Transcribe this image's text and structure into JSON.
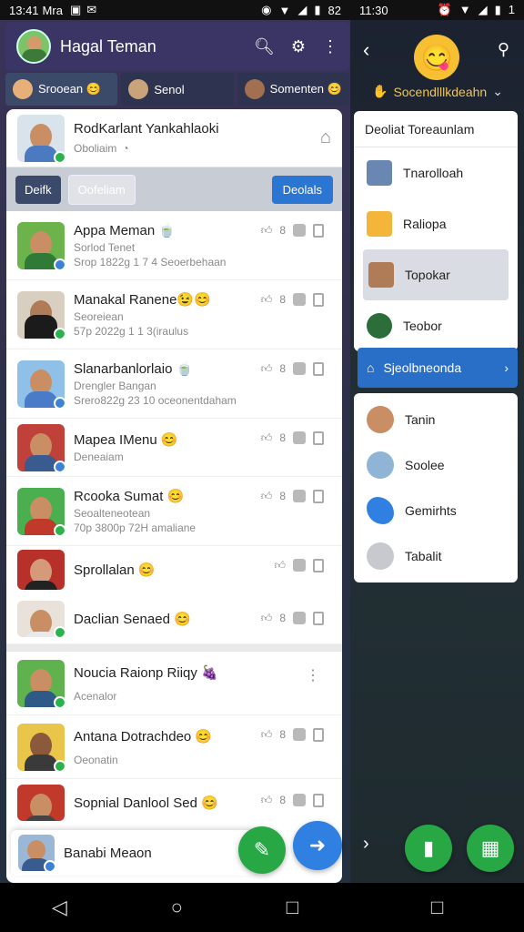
{
  "status_left": {
    "time": "13:41",
    "carrier": "Mra",
    "right": "82"
  },
  "status_right": {
    "time": "11:30",
    "right": "1"
  },
  "appbar": {
    "title": "Hagal Teman"
  },
  "tabs": [
    {
      "label": "Srooean 😊"
    },
    {
      "label": "Senol"
    },
    {
      "label": "Somenten 😊"
    }
  ],
  "header": {
    "name": "RodKarlant Yankahlaoki",
    "sub": "Oboliaim"
  },
  "actions": {
    "left1": "Deifk",
    "left2": "Oofeliam",
    "right": "Deolals"
  },
  "contacts": [
    {
      "name": "Appa Meman 🍵",
      "s1": "Sorlod Tenet",
      "s2": "Srop 1822g 1 7 4 Seoerbehaan"
    },
    {
      "name": "Manakal Ranene😉😊",
      "s1": "Seoreiean",
      "s2": "57p 2022g 1 1 3(iraulus"
    },
    {
      "name": "Slanarbanlorlaio 🍵",
      "s1": "Drengler Bangan",
      "s2": "Srero822g 23 10 oceonentdaham"
    },
    {
      "name": "Mapea IMenu 😊",
      "s1": "Deneaiam",
      "s2": ""
    },
    {
      "name": "Rcooka Sumat 😊",
      "s1": "Seoalteneotean",
      "s2": "70p 3800p 72H amaliane"
    },
    {
      "name": "Sprollalan 😊",
      "s1": "",
      "s2": ""
    },
    {
      "name": "Daclian Senaed 😊",
      "s1": "",
      "s2": ""
    },
    {
      "name": "Noucia Raionp Riiqy 🍇",
      "s1": "Acenalor",
      "s2": ""
    },
    {
      "name": "Antana Dotrachdeo 😊",
      "s1": "Oeonatin",
      "s2": ""
    },
    {
      "name": "Sopnial Danlool Sed 😊",
      "s1": "",
      "s2": ""
    },
    {
      "name": "Banabi Meaon",
      "s1": "",
      "s2": ""
    }
  ],
  "right": {
    "sub": "Socendlllkdeahn",
    "menu_title": "Deoliat Toreaunlam",
    "menu": [
      {
        "label": "Tnarolloah"
      },
      {
        "label": "Raliopa"
      },
      {
        "label": "Topokar"
      },
      {
        "label": "Teobor"
      }
    ],
    "blue_row": "Sjeolbneonda",
    "menu2": [
      {
        "label": "Tanin"
      },
      {
        "label": "Soolee"
      },
      {
        "label": "Gemirhts"
      },
      {
        "label": "Tabalit"
      }
    ]
  },
  "colors": {
    "accent_blue": "#2a76d2",
    "fab_green": "#28a745",
    "appbar": "#3b3566"
  }
}
